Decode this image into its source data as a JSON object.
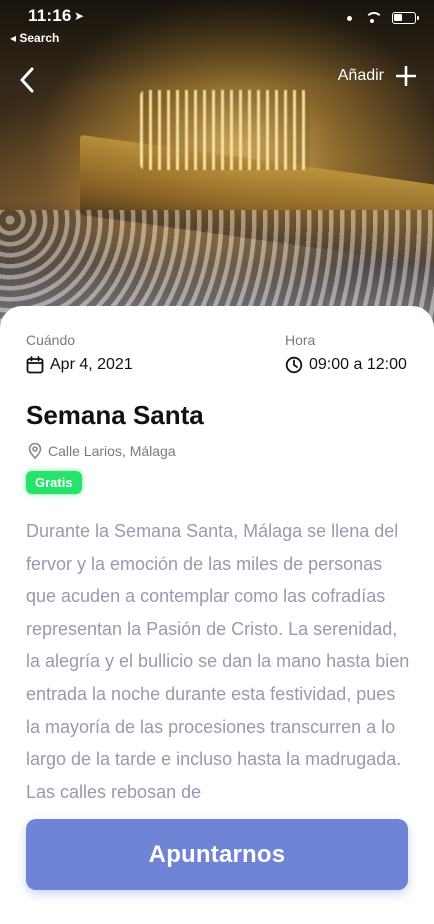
{
  "status_bar": {
    "time": "11:16",
    "back_label": "◂ Search"
  },
  "nav": {
    "add_label": "Añadir"
  },
  "event": {
    "when_label": "Cuándo",
    "date": "Apr 4, 2021",
    "time_label": "Hora",
    "time_range": "09:00 a 12:00",
    "title": "Semana Santa",
    "location": "Calle Larios, Málaga",
    "price_badge": "Gratis",
    "description": "Durante la Semana Santa, Málaga se llena del fervor y la emoción de las miles de personas que acuden a contemplar como las cofradías representan la Pasión de Cristo. La serenidad, la alegría y el bullicio se dan la mano hasta bien entrada la noche durante esta festividad, pues la mayoría de las procesiones transcurren a lo largo de la tarde e incluso hasta la madrugada. Las calles rebosan de"
  },
  "cta": {
    "label": "Apuntarnos"
  },
  "colors": {
    "accent": "#6f84d4",
    "badge_green": "#27e36b",
    "description_text": "#9c98ad",
    "label_gray": "#7a7a7a"
  },
  "icons": {
    "back": "chevron-left-icon",
    "add": "plus-icon",
    "date": "calendar-icon",
    "time": "clock-icon",
    "location": "map-pin-icon",
    "location_services": "location-arrow-icon",
    "wifi": "wifi-icon",
    "battery": "battery-icon"
  }
}
